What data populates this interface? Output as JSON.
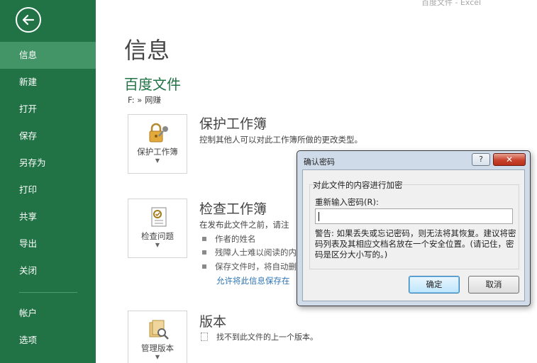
{
  "window": {
    "title": "百度文件 - Excel"
  },
  "sidebar": {
    "back_icon": "back-arrow-icon",
    "items": [
      {
        "label": "信息",
        "active": true
      },
      {
        "label": "新建"
      },
      {
        "label": "打开"
      },
      {
        "label": "保存"
      },
      {
        "label": "另存为"
      },
      {
        "label": "打印"
      },
      {
        "label": "共享"
      },
      {
        "label": "导出"
      },
      {
        "label": "关闭"
      },
      {
        "label": "帐户"
      },
      {
        "label": "选项"
      }
    ],
    "color": "#217346",
    "active_color": "#439467"
  },
  "main": {
    "page_title": "信息",
    "document_name": "百度文件",
    "document_path": "F: » 网赚",
    "protect": {
      "tile_label": "保护工作簿",
      "heading": "保护工作簿",
      "description": "控制其他人可以对此工作簿所做的更改类型。"
    },
    "inspect": {
      "tile_label": "检查问题",
      "heading": "检查工作簿",
      "description": "在发布此文件之前，请注",
      "bullets": [
        "作者的姓名",
        "残障人士难以阅读的内",
        "保存文件时，将自动删"
      ],
      "link": "允许将此信息保存在"
    },
    "versions": {
      "tile_label": "管理版本",
      "heading": "版本",
      "description": "找不到此文件的上一个版本。"
    }
  },
  "dialog": {
    "title": "确认密码",
    "help": "?",
    "close": "✕",
    "group_title": "对此文件的内容进行加密",
    "field_label": "重新输入密码(R):",
    "field_value": "",
    "warning": "警告: 如果丢失或忘记密码，则无法将其恢复。建议将密码列表及其相应文档名放在一个安全位置。(请记住，密码是区分大小写的。)",
    "ok": "确定",
    "cancel": "取消"
  }
}
